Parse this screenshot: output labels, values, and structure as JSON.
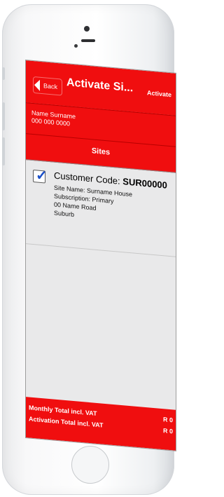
{
  "nav": {
    "back_label": "Back",
    "title": "Activate Si...",
    "action_label": "Activate"
  },
  "user": {
    "name": "Name Surname",
    "phone": "000 000 0000"
  },
  "sites": {
    "title": "Sites",
    "items": [
      {
        "checked": true,
        "customer_code_label": "Customer Code:",
        "customer_code_value": "SUR00000",
        "site_name": "Site Name: Surname House",
        "subscription": "Subscription: Primary",
        "address_line1": "00 Name Road",
        "address_line2": "Suburb"
      }
    ]
  },
  "footer": {
    "monthly_label": "Monthly Total incl. VAT",
    "monthly_value": "R 0",
    "activation_label": "Activation Total incl. VAT",
    "activation_value": "R 0"
  },
  "colors": {
    "accent": "#f00e0f",
    "screen_bg": "#e9e9ea",
    "checkmark": "#1a4fc8"
  }
}
